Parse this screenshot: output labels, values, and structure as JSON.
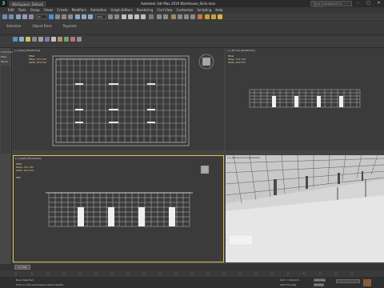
{
  "titlebar": {
    "workspace": "Workspace: Default",
    "title": "Autodesk 3ds Max 2016     Warehouse_Sims.max",
    "search_placeholder": "Type a keyword or phrase"
  },
  "menu": [
    "Edit",
    "Tools",
    "Group",
    "Views",
    "Create",
    "Modifiers",
    "Animation",
    "Graph Editors",
    "Rendering",
    "Civil View",
    "Customize",
    "Scripting",
    "Help"
  ],
  "ribbon": [
    "Selection",
    "Object Paint",
    "Populate"
  ],
  "toolbar": {
    "selection_filter": "All",
    "view_dropdown": "View"
  },
  "leftpanel": {
    "items": [
      "Command",
      "Filter",
      "Name"
    ]
  },
  "viewports": {
    "top": {
      "label": "[+] [Top] [Wireframe]",
      "total": "Total",
      "polys_label": "Polys:",
      "polys": "576 184",
      "verts_label": "Verts:",
      "verts": "909 630"
    },
    "front": {
      "label": "[+] [Front] [Wireframe]",
      "total": "Total",
      "polys_label": "Polys:",
      "polys": "576 184",
      "verts_label": "Verts:",
      "verts": "909 630"
    },
    "left": {
      "label": "[+] [Left] [Wireframe]",
      "total": "Total",
      "polys_label": "Polys:",
      "polys": "576 184",
      "verts_label": "Verts:",
      "verts": "909 630",
      "fps": "FPS:"
    },
    "perspective": {
      "label": "[+] [Perspective] [Realistic]"
    }
  },
  "timeline": {
    "frame": "0 / 100"
  },
  "status": {
    "selection": "None Selected",
    "prompt": "Click or click-and-drag to select objects",
    "grid": "Grid = 100,0cm",
    "autokey": "Auto Key",
    "setkey": "Set Key",
    "add_time_tag": "Add Time Tag"
  }
}
